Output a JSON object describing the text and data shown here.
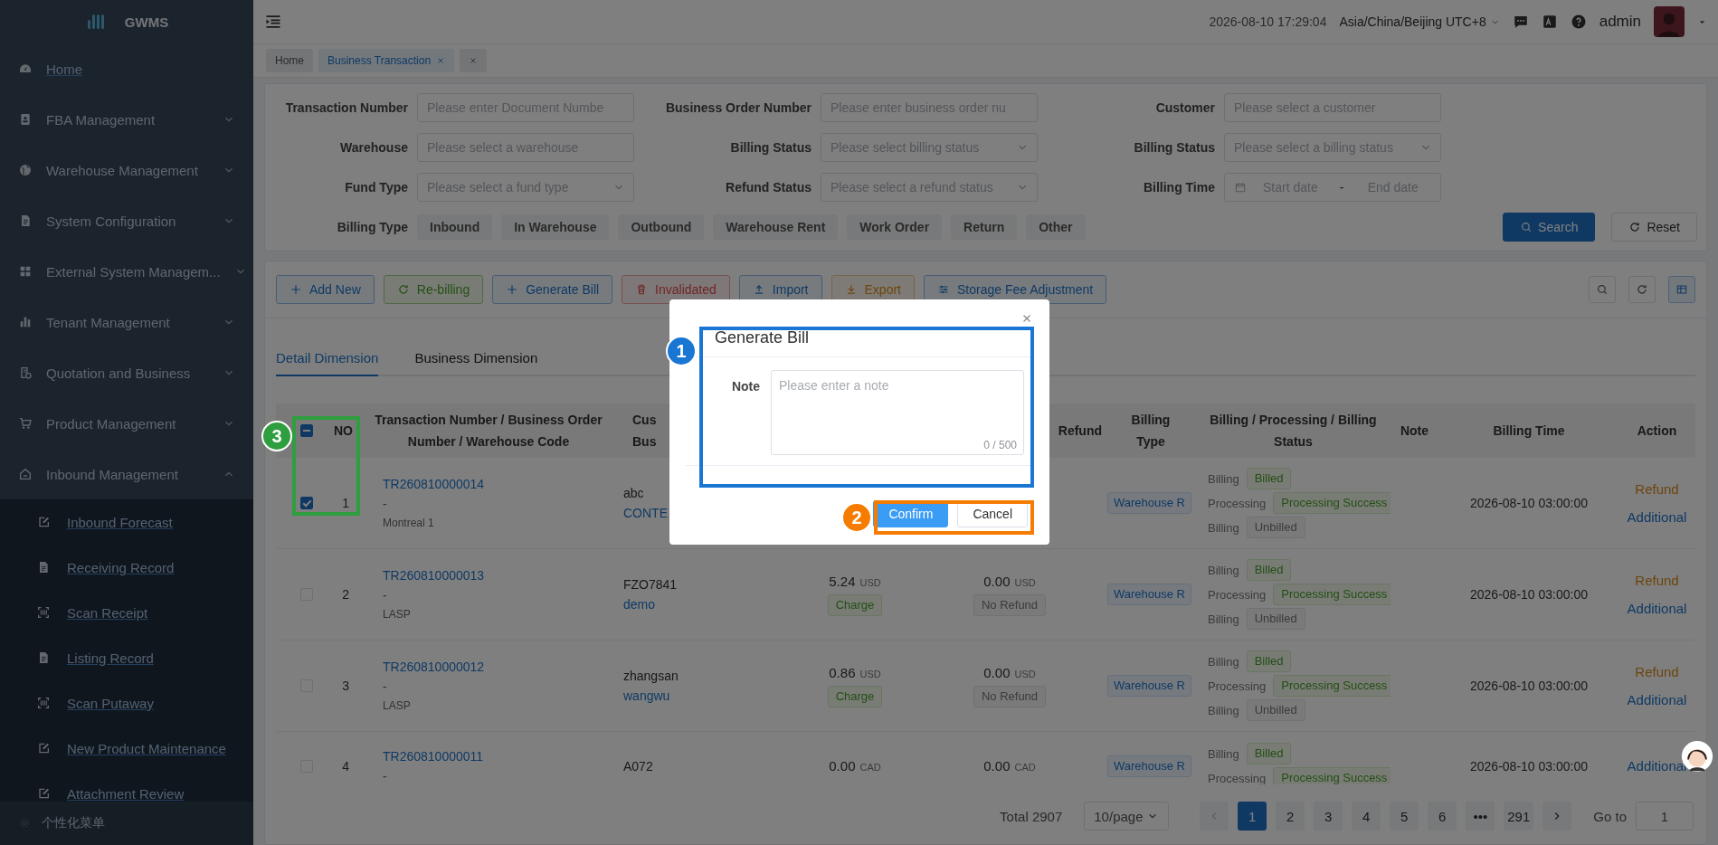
{
  "app": {
    "logo_text": "GWMS"
  },
  "sidebar": {
    "items": [
      {
        "label": "Home"
      },
      {
        "label": "FBA Management",
        "expanded": false
      },
      {
        "label": "Warehouse Management",
        "expanded": false
      },
      {
        "label": "System Configuration",
        "expanded": false
      },
      {
        "label": "External System Managem...",
        "expanded": false
      },
      {
        "label": "Tenant Management",
        "expanded": false
      },
      {
        "label": "Quotation and Business",
        "expanded": false
      },
      {
        "label": "Product Management",
        "expanded": false
      },
      {
        "label": "Inbound Management",
        "expanded": true,
        "children": [
          {
            "label": "Inbound Forecast"
          },
          {
            "label": "Receiving Record"
          },
          {
            "label": "Scan Receipt"
          },
          {
            "label": "Listing Record"
          },
          {
            "label": "Scan Putaway"
          },
          {
            "label": "New Product Maintenance"
          },
          {
            "label": "Attachment Review"
          }
        ]
      }
    ],
    "footer": "个性化菜单"
  },
  "header": {
    "datetime": "2026-08-10 17:29:04",
    "timezone": "Asia/China/Beijing UTC+8",
    "user": "admin"
  },
  "page_tabs": [
    {
      "kind": "page",
      "label": "Home",
      "selected": false
    },
    {
      "kind": "page",
      "label": "Business Transaction",
      "selected": true
    },
    {
      "kind": "close-all",
      "selected": false
    }
  ],
  "filters": {
    "fields": [
      {
        "label": "Transaction Number",
        "kind": "input",
        "placeholder": "Please enter Document Numbe"
      },
      {
        "label": "Business Order Number",
        "kind": "input",
        "placeholder": "Please enter business order nu"
      },
      {
        "label": "Customer",
        "kind": "input",
        "placeholder": "Please select a customer"
      },
      {
        "label": "Warehouse",
        "kind": "input",
        "placeholder": "Please select a warehouse"
      },
      {
        "label": "Billing Status",
        "kind": "select",
        "placeholder": "Please select billing status"
      },
      {
        "label": "Billing Status",
        "kind": "select",
        "placeholder": "Please select a billing status"
      },
      {
        "label": "Fund Type",
        "kind": "select",
        "placeholder": "Please select a fund type"
      },
      {
        "label": "Refund Status",
        "kind": "select",
        "placeholder": "Please select a refund status"
      },
      {
        "label": "Billing Time",
        "kind": "daterange",
        "placeholder": "Start date",
        "separator": "-",
        "end_placeholder": "End date"
      }
    ],
    "billing_type": {
      "label": "Billing Type",
      "options": [
        {
          "label": "Inbound",
          "selected": false
        },
        {
          "label": "In Warehouse",
          "selected": false
        },
        {
          "label": "Outbound",
          "selected": false
        },
        {
          "label": "Warehouse Rent",
          "selected": false
        },
        {
          "label": "Work Order",
          "selected": false
        },
        {
          "label": "Return",
          "selected": false
        },
        {
          "label": "Other",
          "selected": false
        }
      ]
    },
    "search_button": "Search",
    "reset_button": "Reset"
  },
  "toolbar": [
    {
      "label": "Add New",
      "kind": "primary"
    },
    {
      "label": "Re-billing",
      "kind": "success"
    },
    {
      "label": "Generate Bill",
      "kind": "primary"
    },
    {
      "label": "Invalidated",
      "kind": "danger"
    },
    {
      "label": "Import",
      "kind": "primary"
    },
    {
      "label": "Export",
      "kind": "warning"
    },
    {
      "label": "Storage Fee Adjustment",
      "kind": "primary"
    }
  ],
  "view_tabs": [
    {
      "label": "Detail Dimension",
      "selected": true
    },
    {
      "label": "Business Dimension",
      "selected": false
    }
  ],
  "table": {
    "columns": [
      {
        "kind": "checkbox",
        "indeterminate": true
      },
      {
        "kind": "text",
        "lines": [
          "NO"
        ]
      },
      {
        "kind": "text",
        "lines": [
          "Transaction Number / Business Order",
          "Number / Warehouse Code"
        ]
      },
      {
        "kind": "text",
        "lines": [
          "Cus",
          "Bus"
        ]
      },
      {
        "kind": "text",
        "lines": [
          "Refund"
        ]
      },
      {
        "kind": "text",
        "lines": [
          "Billing",
          "Type"
        ]
      },
      {
        "kind": "text",
        "lines": [
          "Billing / Processing / Billing",
          "Status"
        ]
      },
      {
        "kind": "text",
        "lines": [
          "Note"
        ]
      },
      {
        "kind": "text",
        "lines": [
          "Billing Time"
        ]
      },
      {
        "kind": "text",
        "lines": [
          "Action"
        ]
      }
    ],
    "rows": [
      {
        "selected": true,
        "number": "1",
        "transaction": "TR260810000014",
        "business_order": "-",
        "warehouse": "Montreal 1",
        "customer": "abc",
        "business": "CONTE",
        "billing_type": "Warehouse R",
        "statuses": [
          {
            "label": "Billing",
            "value": "Billed",
            "kind": "success"
          },
          {
            "label": "Processing",
            "value": "Processing Success",
            "kind": "success"
          },
          {
            "label": "Billing",
            "value": "Unbilled",
            "kind": "neutral"
          }
        ],
        "billing_time": "2026-08-10 03:00:00",
        "actions": [
          {
            "label": "Refund",
            "kind": "warning"
          },
          {
            "label": "Additional",
            "kind": "primary"
          }
        ]
      },
      {
        "selected": false,
        "number": "2",
        "transaction": "TR260810000013",
        "business_order": "-",
        "warehouse": "LASP",
        "customer": "FZO7841",
        "business": "demo",
        "amount": {
          "value": "5.24",
          "currency": "USD",
          "tag": "Charge"
        },
        "refund": {
          "value": "0.00",
          "currency": "USD",
          "tag": "No Refund"
        },
        "billing_type": "Warehouse R",
        "statuses": [
          {
            "label": "Billing",
            "value": "Billed",
            "kind": "success"
          },
          {
            "label": "Processing",
            "value": "Processing Success",
            "kind": "success"
          },
          {
            "label": "Billing",
            "value": "Unbilled",
            "kind": "neutral"
          }
        ],
        "billing_time": "2026-08-10 03:00:00",
        "actions": [
          {
            "label": "Refund",
            "kind": "warning"
          },
          {
            "label": "Additional",
            "kind": "primary"
          }
        ]
      },
      {
        "selected": false,
        "number": "3",
        "transaction": "TR260810000012",
        "business_order": "-",
        "warehouse": "LASP",
        "customer": "zhangsan",
        "business": "wangwu",
        "amount": {
          "value": "0.86",
          "currency": "USD",
          "tag": "Charge"
        },
        "refund": {
          "value": "0.00",
          "currency": "USD",
          "tag": "No Refund"
        },
        "billing_type": "Warehouse R",
        "statuses": [
          {
            "label": "Billing",
            "value": "Billed",
            "kind": "success"
          },
          {
            "label": "Processing",
            "value": "Processing Success",
            "kind": "success"
          },
          {
            "label": "Billing",
            "value": "Unbilled",
            "kind": "neutral"
          }
        ],
        "billing_time": "2026-08-10 03:00:00",
        "actions": [
          {
            "label": "Refund",
            "kind": "warning"
          },
          {
            "label": "Additional",
            "kind": "primary"
          }
        ]
      },
      {
        "selected": false,
        "number": "4",
        "transaction": "TR260810000011",
        "business_order": "-",
        "customer": "A072",
        "amount": {
          "value": "0.00",
          "currency": "CAD"
        },
        "refund": {
          "value": "0.00",
          "currency": "CAD"
        },
        "billing_type": "Warehouse R",
        "statuses": [
          {
            "label": "Billing",
            "value": "Billed",
            "kind": "success"
          },
          {
            "label": "Processing",
            "value": "Processing Success",
            "kind": "success"
          }
        ],
        "billing_time": "2026-08-10 03:00:00",
        "actions": [
          {
            "label": "Additional",
            "kind": "primary"
          }
        ]
      }
    ]
  },
  "pagination": {
    "total": "Total 2907",
    "page_size": "10/page",
    "pages": [
      {
        "label": "1",
        "selected": true
      },
      {
        "label": "2",
        "selected": false
      },
      {
        "label": "3",
        "selected": false
      },
      {
        "label": "4",
        "selected": false
      },
      {
        "label": "5",
        "selected": false
      },
      {
        "label": "6",
        "selected": false
      },
      {
        "label": "•••",
        "selected": false
      },
      {
        "label": "291",
        "selected": false
      }
    ],
    "goto_label": "Go to",
    "goto_value": "1"
  },
  "dialog": {
    "title": "Generate Bill",
    "note_label": "Note",
    "note_placeholder": "Please enter a note",
    "counter": "0 / 500",
    "confirm": "Confirm",
    "cancel": "Cancel"
  },
  "annotations": [
    {
      "number": "1",
      "color": "#1976d2"
    },
    {
      "number": "2",
      "color": "#f57c00"
    },
    {
      "number": "3",
      "color": "#2e9e3e"
    }
  ]
}
